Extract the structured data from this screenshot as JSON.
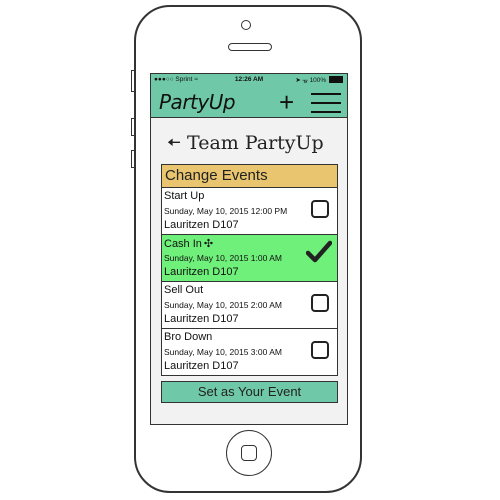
{
  "status_bar": {
    "carrier": "●●●○○ Sprint",
    "time": "12:26 AM",
    "battery_text": "100%"
  },
  "navbar": {
    "brand": "PartyUp",
    "add_icon": "plus-icon",
    "menu_icon": "hamburger-icon"
  },
  "team": {
    "title": "Team PartyUp",
    "back_icon": "arrow-left-icon"
  },
  "events": {
    "header": "Change Events",
    "items": [
      {
        "name": "Start Up",
        "date": "Sunday, May 10, 2015 12:00 PM",
        "location": "Lauritzen D107",
        "selected": false
      },
      {
        "name": "Cash In",
        "date": "Sunday, May 10, 2015 1:00 AM",
        "location": "Lauritzen D107",
        "selected": true
      },
      {
        "name": "Sell Out",
        "date": "Sunday, May 10, 2015 2:00 AM",
        "location": "Lauritzen D107",
        "selected": false
      },
      {
        "name": "Bro Down",
        "date": "Sunday, May 10, 2015 3:00 AM",
        "location": "Lauritzen D107",
        "selected": false
      }
    ]
  },
  "actions": {
    "set_event": "Set as Your Event"
  },
  "colors": {
    "brand_green": "#6fc9a8",
    "header_gold": "#e8c56e",
    "selected_green": "#6ff07a"
  }
}
